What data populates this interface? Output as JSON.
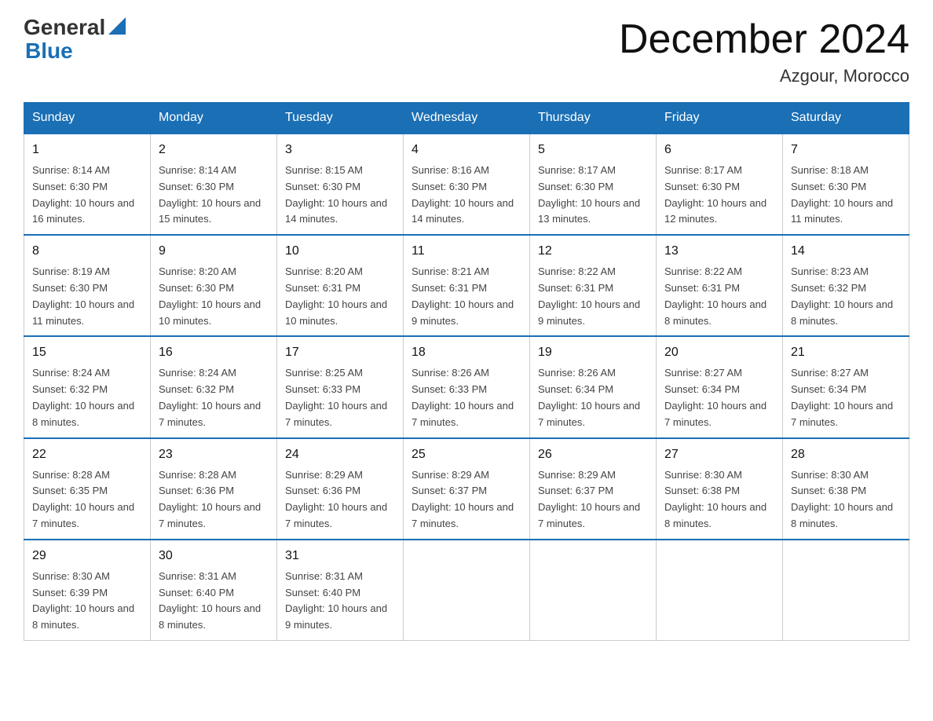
{
  "header": {
    "logo_text1": "General",
    "logo_text2": "Blue",
    "main_title": "December 2024",
    "subtitle": "Azgour, Morocco"
  },
  "calendar": {
    "days_of_week": [
      "Sunday",
      "Monday",
      "Tuesday",
      "Wednesday",
      "Thursday",
      "Friday",
      "Saturday"
    ],
    "weeks": [
      [
        {
          "day": "1",
          "sunrise": "8:14 AM",
          "sunset": "6:30 PM",
          "daylight": "10 hours and 16 minutes."
        },
        {
          "day": "2",
          "sunrise": "8:14 AM",
          "sunset": "6:30 PM",
          "daylight": "10 hours and 15 minutes."
        },
        {
          "day": "3",
          "sunrise": "8:15 AM",
          "sunset": "6:30 PM",
          "daylight": "10 hours and 14 minutes."
        },
        {
          "day": "4",
          "sunrise": "8:16 AM",
          "sunset": "6:30 PM",
          "daylight": "10 hours and 14 minutes."
        },
        {
          "day": "5",
          "sunrise": "8:17 AM",
          "sunset": "6:30 PM",
          "daylight": "10 hours and 13 minutes."
        },
        {
          "day": "6",
          "sunrise": "8:17 AM",
          "sunset": "6:30 PM",
          "daylight": "10 hours and 12 minutes."
        },
        {
          "day": "7",
          "sunrise": "8:18 AM",
          "sunset": "6:30 PM",
          "daylight": "10 hours and 11 minutes."
        }
      ],
      [
        {
          "day": "8",
          "sunrise": "8:19 AM",
          "sunset": "6:30 PM",
          "daylight": "10 hours and 11 minutes."
        },
        {
          "day": "9",
          "sunrise": "8:20 AM",
          "sunset": "6:30 PM",
          "daylight": "10 hours and 10 minutes."
        },
        {
          "day": "10",
          "sunrise": "8:20 AM",
          "sunset": "6:31 PM",
          "daylight": "10 hours and 10 minutes."
        },
        {
          "day": "11",
          "sunrise": "8:21 AM",
          "sunset": "6:31 PM",
          "daylight": "10 hours and 9 minutes."
        },
        {
          "day": "12",
          "sunrise": "8:22 AM",
          "sunset": "6:31 PM",
          "daylight": "10 hours and 9 minutes."
        },
        {
          "day": "13",
          "sunrise": "8:22 AM",
          "sunset": "6:31 PM",
          "daylight": "10 hours and 8 minutes."
        },
        {
          "day": "14",
          "sunrise": "8:23 AM",
          "sunset": "6:32 PM",
          "daylight": "10 hours and 8 minutes."
        }
      ],
      [
        {
          "day": "15",
          "sunrise": "8:24 AM",
          "sunset": "6:32 PM",
          "daylight": "10 hours and 8 minutes."
        },
        {
          "day": "16",
          "sunrise": "8:24 AM",
          "sunset": "6:32 PM",
          "daylight": "10 hours and 7 minutes."
        },
        {
          "day": "17",
          "sunrise": "8:25 AM",
          "sunset": "6:33 PM",
          "daylight": "10 hours and 7 minutes."
        },
        {
          "day": "18",
          "sunrise": "8:26 AM",
          "sunset": "6:33 PM",
          "daylight": "10 hours and 7 minutes."
        },
        {
          "day": "19",
          "sunrise": "8:26 AM",
          "sunset": "6:34 PM",
          "daylight": "10 hours and 7 minutes."
        },
        {
          "day": "20",
          "sunrise": "8:27 AM",
          "sunset": "6:34 PM",
          "daylight": "10 hours and 7 minutes."
        },
        {
          "day": "21",
          "sunrise": "8:27 AM",
          "sunset": "6:34 PM",
          "daylight": "10 hours and 7 minutes."
        }
      ],
      [
        {
          "day": "22",
          "sunrise": "8:28 AM",
          "sunset": "6:35 PM",
          "daylight": "10 hours and 7 minutes."
        },
        {
          "day": "23",
          "sunrise": "8:28 AM",
          "sunset": "6:36 PM",
          "daylight": "10 hours and 7 minutes."
        },
        {
          "day": "24",
          "sunrise": "8:29 AM",
          "sunset": "6:36 PM",
          "daylight": "10 hours and 7 minutes."
        },
        {
          "day": "25",
          "sunrise": "8:29 AM",
          "sunset": "6:37 PM",
          "daylight": "10 hours and 7 minutes."
        },
        {
          "day": "26",
          "sunrise": "8:29 AM",
          "sunset": "6:37 PM",
          "daylight": "10 hours and 7 minutes."
        },
        {
          "day": "27",
          "sunrise": "8:30 AM",
          "sunset": "6:38 PM",
          "daylight": "10 hours and 8 minutes."
        },
        {
          "day": "28",
          "sunrise": "8:30 AM",
          "sunset": "6:38 PM",
          "daylight": "10 hours and 8 minutes."
        }
      ],
      [
        {
          "day": "29",
          "sunrise": "8:30 AM",
          "sunset": "6:39 PM",
          "daylight": "10 hours and 8 minutes."
        },
        {
          "day": "30",
          "sunrise": "8:31 AM",
          "sunset": "6:40 PM",
          "daylight": "10 hours and 8 minutes."
        },
        {
          "day": "31",
          "sunrise": "8:31 AM",
          "sunset": "6:40 PM",
          "daylight": "10 hours and 9 minutes."
        },
        null,
        null,
        null,
        null
      ]
    ]
  }
}
